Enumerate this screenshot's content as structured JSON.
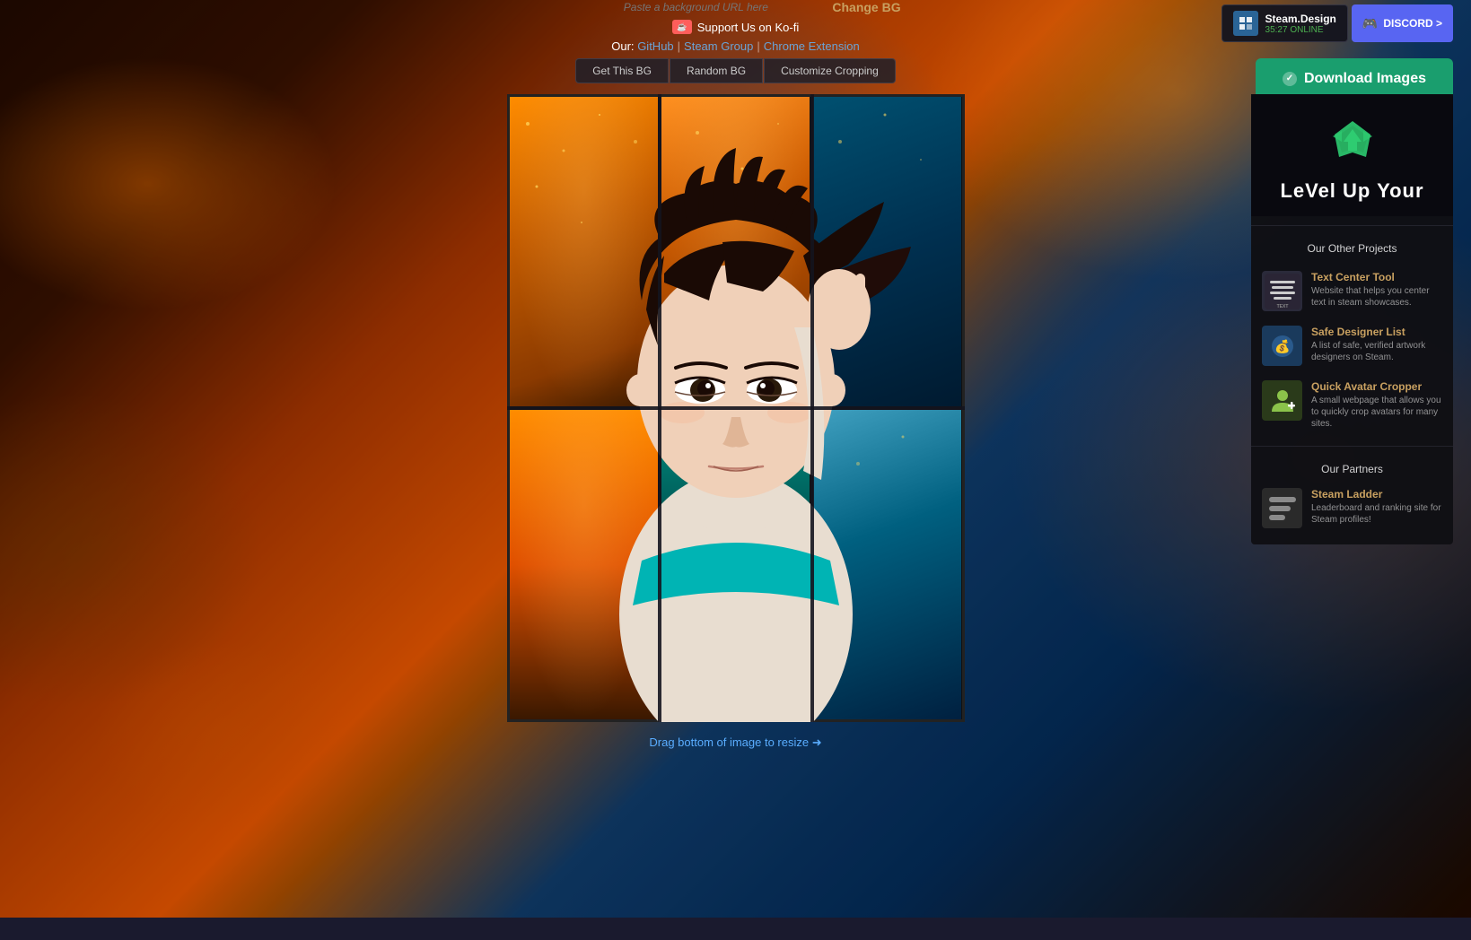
{
  "header": {
    "url_placeholder": "Paste a background URL here",
    "change_bg_label": "Change BG",
    "kofi_label": "Support Us on Ko-fi",
    "links": {
      "prefix": "Our:",
      "github": "GitHub",
      "steam_group": "Steam Group",
      "chrome_extension": "Chrome Extension"
    },
    "actions": {
      "get_bg": "Get This BG",
      "random_bg": "Random BG",
      "customize_cropping": "Customize Cropping"
    }
  },
  "steam_design_card": {
    "title": "Steam.Design",
    "online_text": "35:27 ONLINE"
  },
  "discord_card": {
    "label": "DISCORD >"
  },
  "download_button": {
    "label": "Download Images"
  },
  "sidebar": {
    "level_up_text": "LeVel Up Your",
    "our_projects_title": "Our Other Projects",
    "projects": [
      {
        "title": "Text Center Tool",
        "description": "Website that helps you center text in steam showcases.",
        "icon_type": "text-center",
        "icon_label": "Steam Center Text"
      },
      {
        "title": "Safe Designer List",
        "description": "A list of safe, verified artwork designers on Steam.",
        "icon_type": "safe-designer",
        "icon_symbol": "💰"
      },
      {
        "title": "Quick Avatar Cropper",
        "description": "A small webpage that allows you to quickly crop avatars for many sites.",
        "icon_type": "avatar-cropper",
        "icon_symbol": "⊞"
      }
    ],
    "our_partners_title": "Our Partners",
    "partners": [
      {
        "title": "Steam Ladder",
        "description": "Leaderboard and ranking site for Steam profiles!"
      }
    ]
  },
  "drag_handle": {
    "label": "Drag bottom of image to resize ➜"
  }
}
